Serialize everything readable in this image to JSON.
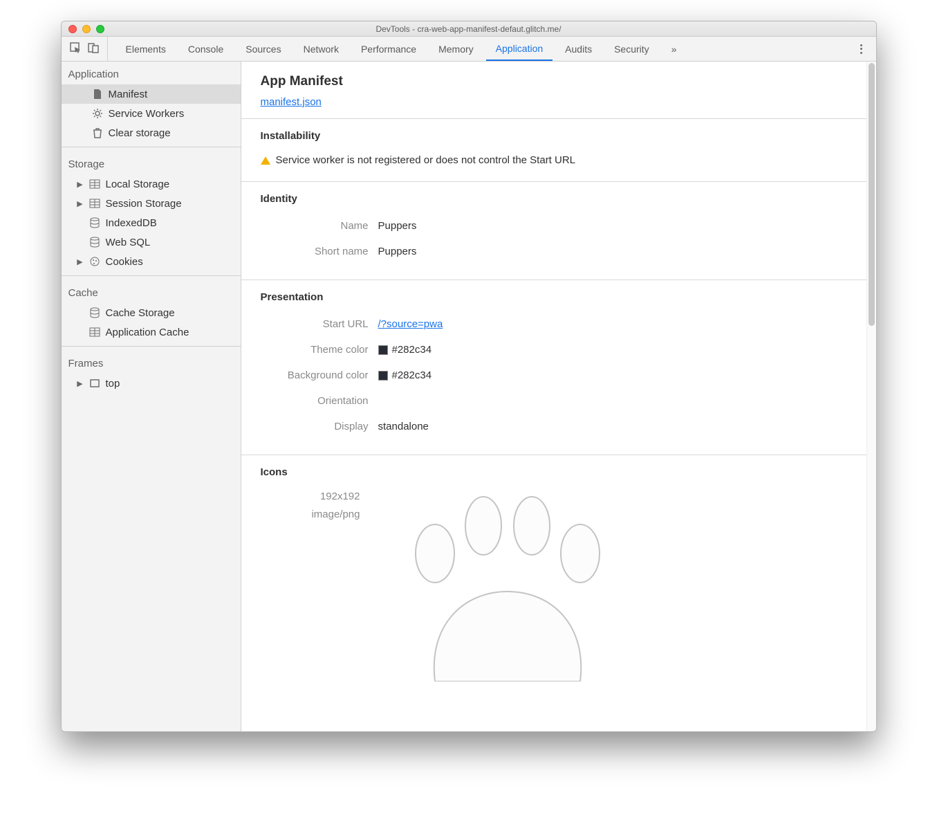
{
  "window": {
    "title": "DevTools - cra-web-app-manifest-defaut.glitch.me/"
  },
  "tabs": {
    "items": [
      "Elements",
      "Console",
      "Sources",
      "Network",
      "Performance",
      "Memory",
      "Application",
      "Audits",
      "Security"
    ],
    "active": "Application",
    "overflow": "»"
  },
  "sidebar": {
    "sections": [
      {
        "title": "Application",
        "items": [
          {
            "label": "Manifest",
            "icon": "file",
            "selected": true
          },
          {
            "label": "Service Workers",
            "icon": "gear"
          },
          {
            "label": "Clear storage",
            "icon": "trash"
          }
        ]
      },
      {
        "title": "Storage",
        "items": [
          {
            "label": "Local Storage",
            "icon": "grid",
            "expandable": true
          },
          {
            "label": "Session Storage",
            "icon": "grid",
            "expandable": true
          },
          {
            "label": "IndexedDB",
            "icon": "db"
          },
          {
            "label": "Web SQL",
            "icon": "db"
          },
          {
            "label": "Cookies",
            "icon": "cookie",
            "expandable": true
          }
        ]
      },
      {
        "title": "Cache",
        "items": [
          {
            "label": "Cache Storage",
            "icon": "db"
          },
          {
            "label": "Application Cache",
            "icon": "grid"
          }
        ]
      },
      {
        "title": "Frames",
        "items": [
          {
            "label": "top",
            "icon": "frame",
            "expandable": true
          }
        ]
      }
    ]
  },
  "main": {
    "title": "App Manifest",
    "manifest_link": "manifest.json",
    "installability": {
      "heading": "Installability",
      "warning": "Service worker is not registered or does not control the Start URL"
    },
    "identity": {
      "heading": "Identity",
      "rows": [
        {
          "k": "Name",
          "v": "Puppers"
        },
        {
          "k": "Short name",
          "v": "Puppers"
        }
      ]
    },
    "presentation": {
      "heading": "Presentation",
      "rows": [
        {
          "k": "Start URL",
          "link": "/?source=pwa"
        },
        {
          "k": "Theme color",
          "swatch": "#282c34",
          "v": "#282c34"
        },
        {
          "k": "Background color",
          "swatch": "#282c34",
          "v": "#282c34"
        },
        {
          "k": "Orientation",
          "v": ""
        },
        {
          "k": "Display",
          "v": "standalone"
        }
      ]
    },
    "icons": {
      "heading": "Icons",
      "meta": [
        "192x192",
        "image/png"
      ]
    }
  }
}
